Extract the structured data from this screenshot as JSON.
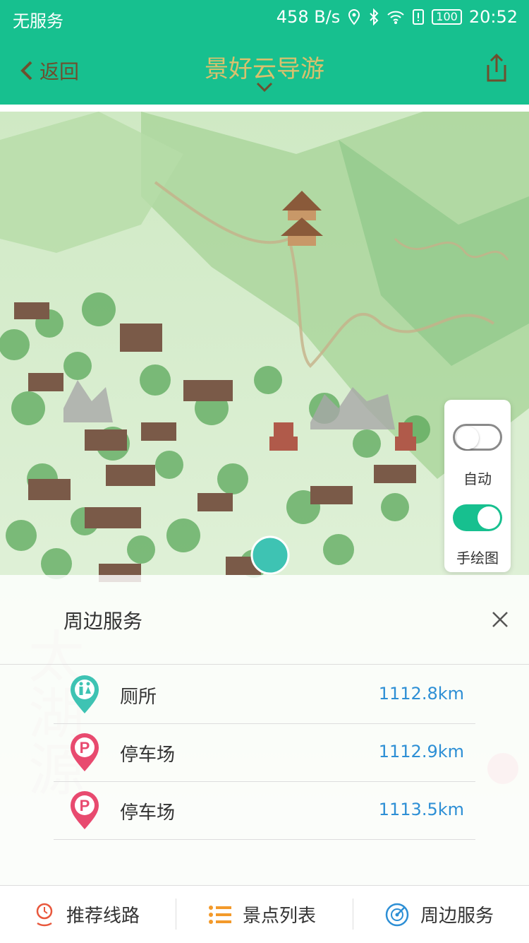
{
  "status": {
    "carrier": "无服务",
    "speed": "458 B/s",
    "battery": "100",
    "time": "20:52"
  },
  "nav": {
    "back_label": "返回",
    "title": "景好云导游"
  },
  "toggles": {
    "auto_label": "自动",
    "handdrawn_label": "手绘图"
  },
  "services": {
    "title": "周边服务",
    "items": [
      {
        "name": "厕所",
        "distance": "1112.8km",
        "icon": "toilet-icon"
      },
      {
        "name": "停车场",
        "distance": "1112.9km",
        "icon": "parking-icon"
      },
      {
        "name": "停车场",
        "distance": "1113.5km",
        "icon": "parking-icon"
      }
    ]
  },
  "tabs": {
    "route": "推荐线路",
    "list": "景点列表",
    "nearby": "周边服务"
  },
  "colors": {
    "accent": "#17c08f",
    "title": "#d9c16d",
    "distance": "#2d8fd5",
    "parking": "#e84a6f",
    "toilet": "#3ec3b3"
  }
}
